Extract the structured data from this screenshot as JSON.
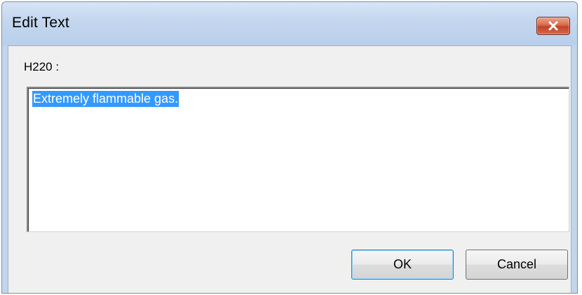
{
  "window": {
    "title": "Edit Text"
  },
  "titlebar": {
    "close_icon": "close-icon"
  },
  "form": {
    "label": "H220 :",
    "text_value": "Extremely flammable gas."
  },
  "buttons": {
    "ok_label": "OK",
    "cancel_label": "Cancel"
  },
  "colors": {
    "selection": "#3399ff",
    "close_button": "#c7452c",
    "titlebar": "#c3d6ee"
  }
}
